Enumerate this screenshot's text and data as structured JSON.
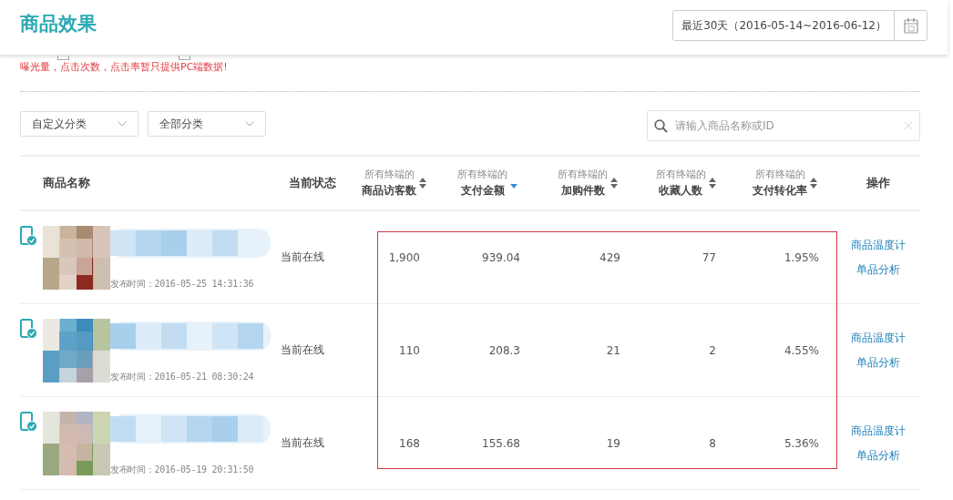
{
  "header": {
    "title": "商品效果",
    "date_range": "最近30天（2016-05-14~2016-06-12）"
  },
  "options": [
    {
      "checked": false
    },
    {
      "checked": false
    }
  ],
  "notice": "曝光量，点击次数，点击率暂只提供PC端数据!",
  "filters": [
    {
      "label": "自定义分类"
    },
    {
      "label": "全部分类"
    }
  ],
  "search": {
    "placeholder": "请输入商品名称或ID"
  },
  "table": {
    "columns": [
      {
        "label": "商品名称",
        "kind": "plain"
      },
      {
        "label": "当前状态",
        "kind": "plain"
      },
      {
        "prefix": "所有终端的",
        "label": "商品访客数",
        "kind": "sortable",
        "sorted": false
      },
      {
        "prefix": "所有终端的",
        "label": "支付金额",
        "kind": "sortable",
        "sorted": true
      },
      {
        "prefix": "所有终端的",
        "label": "加购件数",
        "kind": "sortable",
        "sorted": false
      },
      {
        "prefix": "所有终端的",
        "label": "收藏人数",
        "kind": "sortable",
        "sorted": false
      },
      {
        "prefix": "所有终端的",
        "label": "支付转化率",
        "kind": "sortable",
        "sorted": false
      },
      {
        "label": "操作",
        "kind": "plain"
      }
    ],
    "rows": [
      {
        "published": "发布时间：2016-05-25 14:31:36",
        "status": "当前在线",
        "values": [
          "1,900",
          "939.04",
          "429",
          "77",
          "1.95%"
        ],
        "actions": [
          "商品温度计",
          "单品分析"
        ]
      },
      {
        "published": "发布时间：2016-05-21 08:30:24",
        "status": "当前在线",
        "values": [
          "110",
          "208.3",
          "21",
          "2",
          "4.55%"
        ],
        "actions": [
          "商品温度计",
          "单品分析"
        ]
      },
      {
        "published": "发布时间：2016-05-19 20:31:50",
        "status": "当前在线",
        "values": [
          "168",
          "155.68",
          "19",
          "8",
          "5.36%"
        ],
        "actions": [
          "商品温度计",
          "单品分析"
        ]
      }
    ]
  }
}
